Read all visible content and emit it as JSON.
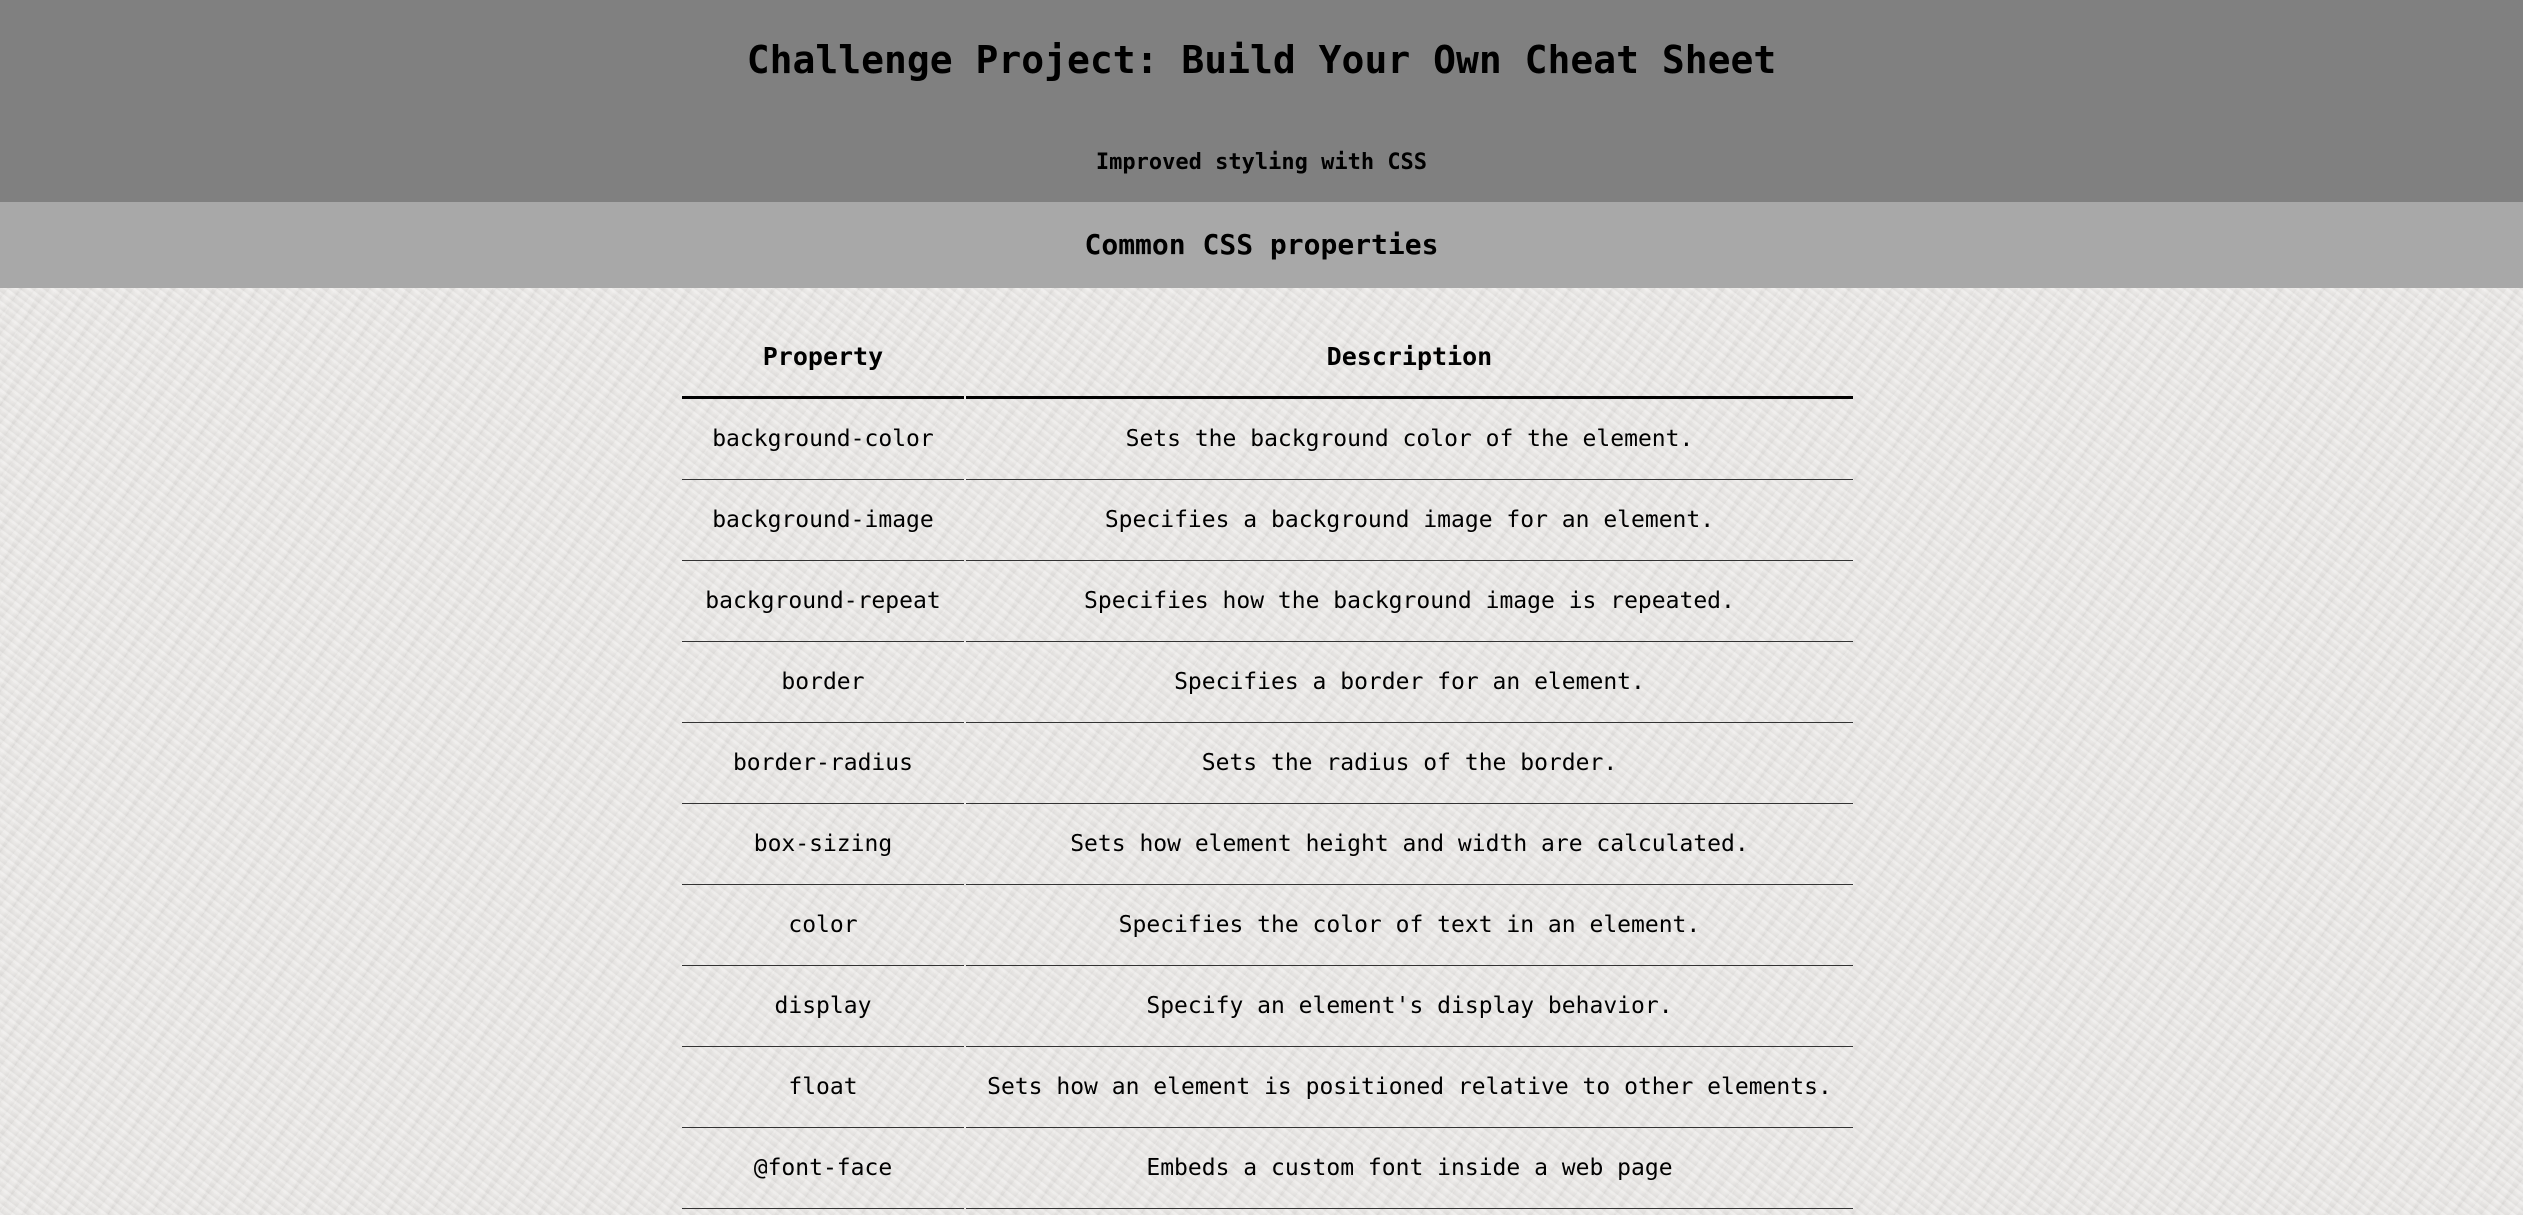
{
  "header": {
    "title": "Challenge Project: Build Your Own Cheat Sheet",
    "subtitle": "Improved styling with CSS"
  },
  "section": {
    "title": "Common CSS properties"
  },
  "table": {
    "columns": [
      "Property",
      "Description"
    ],
    "rows": [
      {
        "property": "background-color",
        "description": "Sets the background color of the element."
      },
      {
        "property": "background-image",
        "description": "Specifies a background image for an element."
      },
      {
        "property": "background-repeat",
        "description": "Specifies how the background image is repeated."
      },
      {
        "property": "border",
        "description": "Specifies a border for an element."
      },
      {
        "property": "border-radius",
        "description": "Sets the radius of the border."
      },
      {
        "property": "box-sizing",
        "description": "Sets how element height and width are calculated."
      },
      {
        "property": "color",
        "description": "Specifies the color of text in an element."
      },
      {
        "property": "display",
        "description": "Specify an element's display behavior."
      },
      {
        "property": "float",
        "description": "Sets how an element is positioned relative to other elements."
      },
      {
        "property": "@font-face",
        "description": "Embeds a custom font inside a web page"
      }
    ]
  },
  "colors": {
    "header_bg": "#808080",
    "section_bg": "#a8a8a8",
    "page_bg": "#ebe9e7"
  }
}
